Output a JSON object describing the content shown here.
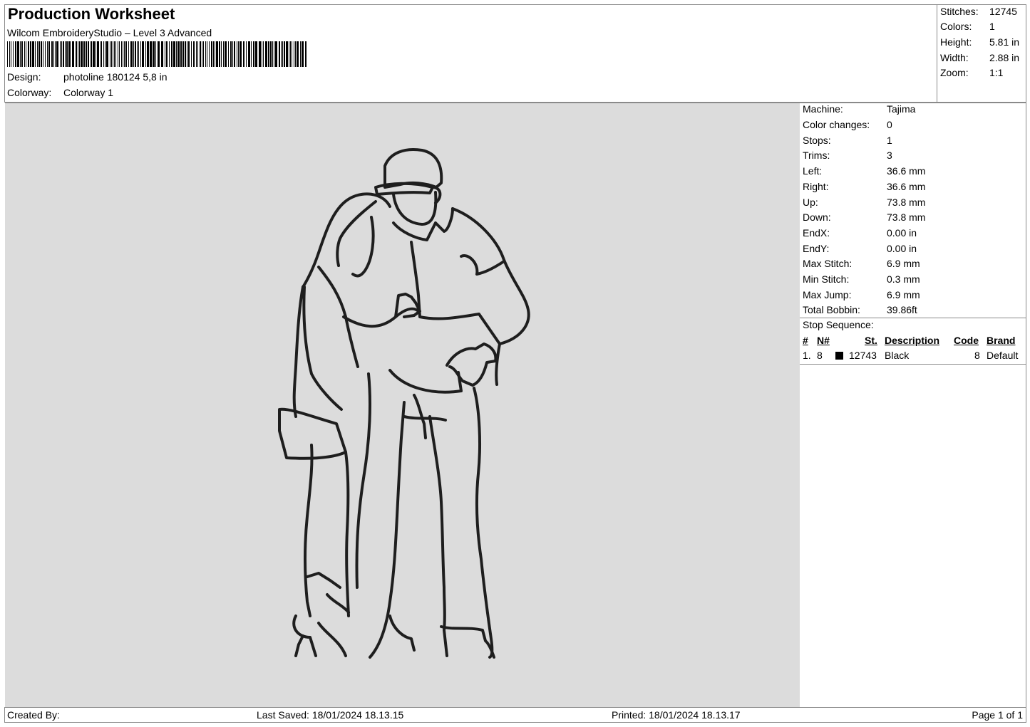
{
  "header": {
    "title": "Production Worksheet",
    "subtitle": "Wilcom EmbroideryStudio – Level 3 Advanced",
    "design_label": "Design:",
    "design_value": "photoline 180124 5,8 in",
    "colorway_label": "Colorway:",
    "colorway_value": "Colorway 1"
  },
  "summary": {
    "stitches_label": "Stitches:",
    "stitches": "12745",
    "colors_label": "Colors:",
    "colors": "1",
    "height_label": "Height:",
    "height": "5.81 in",
    "width_label": "Width:",
    "width": "2.88 in",
    "zoom_label": "Zoom:",
    "zoom": "1:1"
  },
  "machine_info": [
    {
      "label": "Machine:",
      "value": "Tajima"
    },
    {
      "label": "Color changes:",
      "value": "0"
    },
    {
      "label": "Stops:",
      "value": "1"
    },
    {
      "label": "Trims:",
      "value": "3"
    },
    {
      "label": "Left:",
      "value": "36.6 mm"
    },
    {
      "label": "Right:",
      "value": "36.6 mm"
    },
    {
      "label": "Up:",
      "value": "73.8 mm"
    },
    {
      "label": "Down:",
      "value": "73.8 mm"
    },
    {
      "label": "EndX:",
      "value": "0.00 in"
    },
    {
      "label": "EndY:",
      "value": "0.00 in"
    },
    {
      "label": "Max Stitch:",
      "value": "6.9 mm"
    },
    {
      "label": "Min Stitch:",
      "value": "0.3 mm"
    },
    {
      "label": "Max Jump:",
      "value": "6.9 mm"
    },
    {
      "label": "Total Bobbin:",
      "value": "39.86ft"
    }
  ],
  "stop_sequence": {
    "label": "Stop Sequence:",
    "columns": {
      "index": "#",
      "needle": "N#",
      "stitches": "St.",
      "description": "Description",
      "code": "Code",
      "brand": "Brand"
    },
    "rows": [
      {
        "index": "1.",
        "needle": "8",
        "color": "#000000",
        "stitches": "12743",
        "description": "Black",
        "code": "8",
        "brand": "Default"
      }
    ]
  },
  "footer": {
    "created_by": "Created By:",
    "last_saved": "Last Saved: 18/01/2024 18.13.15",
    "printed": "Printed: 18/01/2024 18.13.17",
    "page": "Page 1 of 1"
  },
  "colors": {
    "preview_background": "#dcdcdc",
    "thread": "#1e1e1e",
    "border": "#8a8a8a"
  }
}
